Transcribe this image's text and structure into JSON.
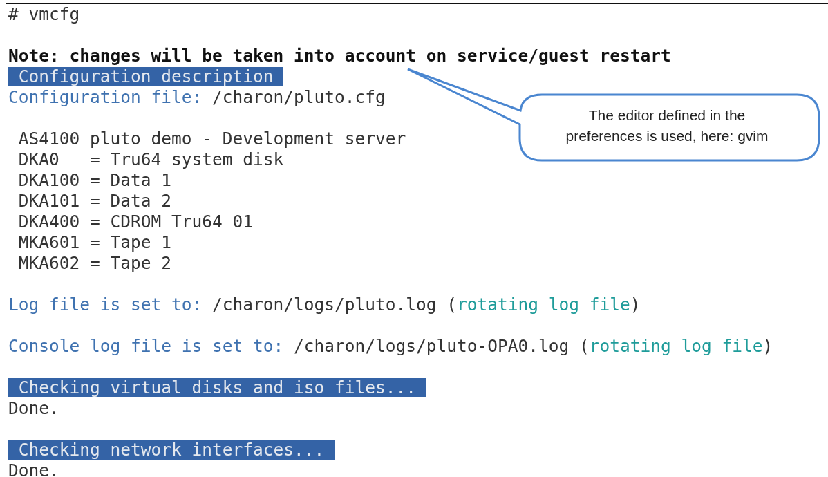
{
  "terminal": {
    "lines": [
      {
        "kind": "plain",
        "segments": [
          {
            "kind": "value",
            "text": "# vmcfg"
          }
        ]
      },
      {
        "kind": "blank"
      },
      {
        "kind": "plain",
        "segments": [
          {
            "kind": "note",
            "text": "Note: changes will be taken into account on service/guest restart"
          }
        ]
      },
      {
        "kind": "header",
        "segments": [
          {
            "kind": "header",
            "text": "Configuration description"
          }
        ]
      },
      {
        "kind": "plain",
        "segments": [
          {
            "kind": "label",
            "text": "Configuration file: "
          },
          {
            "kind": "value",
            "text": "/charon/pluto.cfg"
          }
        ]
      },
      {
        "kind": "blank"
      },
      {
        "kind": "item",
        "segments": [
          {
            "kind": "value",
            "text": "AS4100 pluto demo - Development server"
          }
        ]
      },
      {
        "kind": "item",
        "segments": [
          {
            "kind": "value",
            "text": "DKA0   = Tru64 system disk"
          }
        ]
      },
      {
        "kind": "item",
        "segments": [
          {
            "kind": "value",
            "text": "DKA100 = Data 1"
          }
        ]
      },
      {
        "kind": "item",
        "segments": [
          {
            "kind": "value",
            "text": "DKA101 = Data 2"
          }
        ]
      },
      {
        "kind": "item",
        "segments": [
          {
            "kind": "value",
            "text": "DKA400 = CDROM Tru64 01"
          }
        ]
      },
      {
        "kind": "item",
        "segments": [
          {
            "kind": "value",
            "text": "MKA601 = Tape 1"
          }
        ]
      },
      {
        "kind": "item",
        "segments": [
          {
            "kind": "value",
            "text": "MKA602 = Tape 2"
          }
        ]
      },
      {
        "kind": "blank"
      },
      {
        "kind": "plain",
        "segments": [
          {
            "kind": "label",
            "text": "Log file is set to: "
          },
          {
            "kind": "value",
            "text": "/charon/logs/pluto.log ("
          },
          {
            "kind": "accent",
            "text": "rotating log file"
          },
          {
            "kind": "value",
            "text": ")"
          }
        ]
      },
      {
        "kind": "blank"
      },
      {
        "kind": "plain",
        "segments": [
          {
            "kind": "label",
            "text": "Console log file is set to: "
          },
          {
            "kind": "value",
            "text": "/charon/logs/pluto-OPA0.log ("
          },
          {
            "kind": "accent",
            "text": "rotating log file"
          },
          {
            "kind": "value",
            "text": ")"
          }
        ]
      },
      {
        "kind": "blank"
      },
      {
        "kind": "header",
        "segments": [
          {
            "kind": "header",
            "text": "Checking virtual disks and iso files..."
          }
        ]
      },
      {
        "kind": "plain",
        "segments": [
          {
            "kind": "value",
            "text": "Done."
          }
        ]
      },
      {
        "kind": "blank"
      },
      {
        "kind": "header",
        "segments": [
          {
            "kind": "header",
            "text": "Checking network interfaces..."
          }
        ]
      },
      {
        "kind": "plain",
        "segments": [
          {
            "kind": "value",
            "text": "Done."
          }
        ]
      }
    ]
  },
  "callout": {
    "text": "The editor defined in the preferences is used, here: gvim"
  }
}
